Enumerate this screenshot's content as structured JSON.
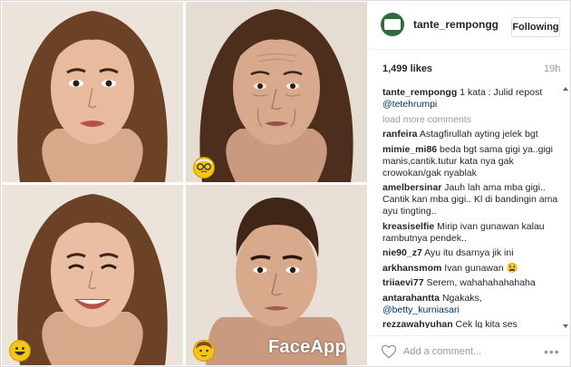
{
  "post": {
    "username": "tante_rempongg",
    "follow_label": "Following",
    "likes": "1,499 likes",
    "time": "19h",
    "caption_user": "tante_rempongg",
    "caption_text": "1 kata : Julid repost ",
    "caption_mention": "@tetehrumpi",
    "load_more": "load more comments",
    "comments": [
      {
        "user": "ranfeira",
        "text": "Astagfirullah ayting jelek bgt"
      },
      {
        "user": "mimie_mi86",
        "text": "beda bgt sama gigi ya..gigi manis,cantik.tutur kata nya gak crowokan/gak nyablak"
      },
      {
        "user": "amelbersinar",
        "text": "Jauh lah ama mba gigi.. Cantik kan mba gigi.. Kl di bandingin ama ayu tingting.."
      },
      {
        "user": "kreasiselfie",
        "text": "Mirip ivan gunawan kalau rambutnya pendek.."
      },
      {
        "user": "nie90_z7",
        "text": "Ayu itu dsarnya jik ini"
      },
      {
        "user": "arkhansmom",
        "text": "Ivan gunawan 😫"
      },
      {
        "user": "triiaevi77",
        "text": "Serem, wahahahahahaha"
      },
      {
        "user": "antarahantta",
        "text": "Ngakaks,",
        "mention": "@betty_kurniasari"
      },
      {
        "user": "rezzawahyuhan",
        "text": "Cek lg kita ses"
      }
    ],
    "add_comment_placeholder": "Add a comment...",
    "more_label": "•••"
  },
  "photo": {
    "watermark": "FaceApp",
    "panels": [
      "original-face",
      "old-filter-face",
      "smile-filter-face",
      "male-filter-face"
    ],
    "icons": [
      "old-emoji-icon",
      "smile-emoji-icon",
      "male-emoji-icon"
    ]
  },
  "colors": {
    "border": "#dbdbdb",
    "text": "#262626",
    "muted": "#999999",
    "mention": "#003569",
    "hair": "#6b4226",
    "skin": "#e6b79a"
  }
}
